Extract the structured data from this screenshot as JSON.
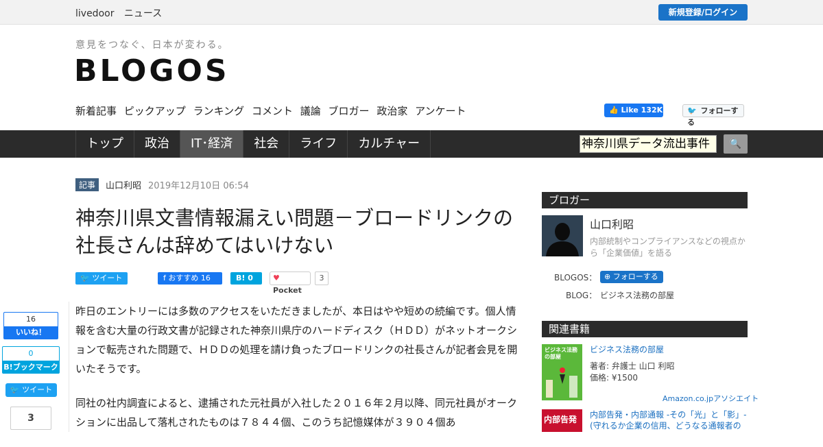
{
  "topbar": {
    "brand1": "livedoor",
    "brand2": "ニュース",
    "login": "新規登録/ログイン"
  },
  "header": {
    "tagline": "意見をつなぐ、日本が変わる。",
    "logo": "BLOGOS"
  },
  "subnav": [
    "新着記事",
    "ピックアップ",
    "ランキング",
    "コメント",
    "議論",
    "ブロガー",
    "政治家",
    "アンケート"
  ],
  "social": {
    "fb_like": "Like 132K",
    "tw_follow": "フォローする"
  },
  "mainnav": [
    "トップ",
    "政治",
    "IT･経済",
    "社会",
    "ライフ",
    "カルチャー"
  ],
  "search": {
    "value": "神奈川県データ流出事件",
    "button": "🔍"
  },
  "article": {
    "badge": "記事",
    "author": "山口利昭",
    "date": "2019年12月10日 06:54",
    "title": "神奈川県文書情報漏えい問題－ブロードリンクの社長さんは辞めてはいけない",
    "share_tweet": "ツイート",
    "share_fb": "おすすめ 16",
    "share_hb": "B! 0",
    "pocket": "Pocket",
    "pocket_count": "3",
    "p1": "昨日のエントリーには多数のアクセスをいただきましたが、本日はやや短めの続編です。個人情報を含む大量の行政文書が記録された神奈川県庁のハードディスク（ＨＤＤ）がネットオークションで転売された問題で、ＨＤＤの処理を請け負ったブロードリンクの社長さんが記者会見を開いたそうです。",
    "p2": "同社の社内調査によると、逮捕された元社員が入社した２０１６年２月以降、同元社員がオークションに出品して落札されたものは７８４４個、このうち記憶媒体が３９０４個あ"
  },
  "float_share": {
    "fb_count": "16",
    "fb_label": "いいね！",
    "hb_count": "0",
    "hb_label": "B!ブックマーク",
    "tw_label": "ツイート",
    "pocket_count": "3"
  },
  "sidebar": {
    "blogger_heading": "ブロガー",
    "blogger_name": "山口利昭",
    "blogger_desc": "内部統制やコンプライアンスなどの視点から「企業価値」を語る",
    "blogos_label": "BLOGOS：",
    "follow": "フォローする",
    "blog_label": "BLOG：",
    "blog_name": "ビジネス法務の部屋",
    "books_heading": "関連書籍",
    "book1_title": "ビジネス法務の部屋",
    "book1_author": "著者: 弁護士 山口 利昭",
    "book1_price": "価格: ¥1500",
    "book1_cover_text": "ビジネス法務の部屋",
    "amazon": "Amazon.co.jpアソシエイト",
    "book2_title": "内部告発・内部通報 -その「光」と「影」- (守れるか企業の信用、どうなる通報者の",
    "book2_cover_text": "内部告発"
  }
}
